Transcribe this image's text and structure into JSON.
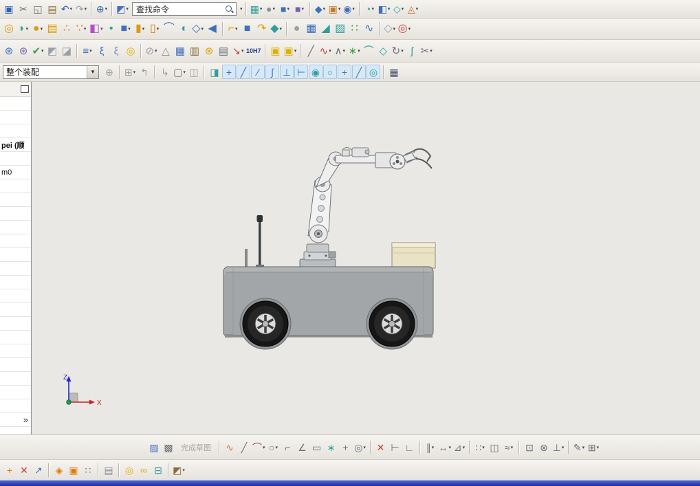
{
  "search": {
    "value": "查找命令"
  },
  "assembly_combo": {
    "value": "整个装配"
  },
  "left_panel": {
    "expand_arrow": "»",
    "rows": [
      {
        "label": ""
      },
      {
        "label": ""
      },
      {
        "label": ""
      },
      {
        "label": "pei (顺",
        "bold": true
      },
      {
        "label": ""
      },
      {
        "label": "m0"
      },
      {
        "label": ""
      },
      {
        "label": ""
      },
      {
        "label": ""
      },
      {
        "label": ""
      },
      {
        "label": ""
      },
      {
        "label": ""
      },
      {
        "label": ""
      },
      {
        "label": ""
      },
      {
        "label": ""
      },
      {
        "label": ""
      },
      {
        "label": ""
      },
      {
        "label": ""
      },
      {
        "label": ""
      },
      {
        "label": ""
      },
      {
        "label": ""
      },
      {
        "label": ""
      },
      {
        "label": ""
      },
      {
        "label": ""
      }
    ]
  },
  "viewport": {
    "triad": {
      "z_label": "Z",
      "x_label": "X"
    }
  },
  "bottom": {
    "finish_label": "完成草图"
  },
  "toolbars": {
    "row1a": [
      {
        "name": "window-menu-icon",
        "glyph": "▣",
        "color": "#2b5fb4"
      },
      {
        "name": "cut-icon",
        "glyph": "✂",
        "color": "#6b7076"
      },
      {
        "name": "copy-icon",
        "glyph": "◱",
        "color": "#6b7076"
      },
      {
        "name": "paste-icon",
        "glyph": "▤",
        "color": "#8a6d3b"
      },
      {
        "name": "undo-icon",
        "glyph": "↶",
        "color": "#2b5fb4",
        "dd": true
      },
      {
        "name": "redo-icon",
        "glyph": "↷",
        "color": "#9aa0a6",
        "dd": true
      },
      {
        "name": "datum-csys-icon",
        "glyph": "⊕",
        "color": "#2b5fb4",
        "dd": true,
        "sep": true
      },
      {
        "name": "sketch-icon",
        "glyph": "◩",
        "color": "#3f6fbf",
        "dd": true,
        "sep": true
      }
    ],
    "row1b": [
      {
        "name": "snap-view-icon",
        "glyph": "▦",
        "color": "#2f9e9e",
        "dd": true,
        "sep": true
      },
      {
        "name": "rotate-view-icon",
        "glyph": "●",
        "color": "#8e9399",
        "dd": true
      },
      {
        "name": "extrude-icon",
        "glyph": "■",
        "color": "#3f6fbf",
        "dd": true
      },
      {
        "name": "block-icon",
        "glyph": "■",
        "color": "#7a5fb4",
        "dd": true
      },
      {
        "name": "boolean-icon",
        "glyph": "◆",
        "color": "#3f6fbf",
        "dd": true,
        "sep": true
      },
      {
        "name": "feature-group-icon",
        "glyph": "▣",
        "color": "#c47a2b",
        "dd": true
      },
      {
        "name": "hole-icon",
        "glyph": "◉",
        "color": "#3f6fbf",
        "dd": true
      },
      {
        "name": "edge-blend-icon",
        "glyph": "◔",
        "color": "#2f9e9e",
        "dd": true,
        "sep": true
      },
      {
        "name": "move-face-icon",
        "glyph": "◧",
        "color": "#3f6fbf",
        "dd": true
      },
      {
        "name": "sheet-icon",
        "glyph": "◇",
        "color": "#2f9e9e",
        "dd": true
      },
      {
        "name": "analysis-icon",
        "glyph": "◬",
        "color": "#c47a2b",
        "dd": true
      }
    ],
    "row2": [
      {
        "name": "torus-icon",
        "glyph": "◎",
        "color": "#e09b00"
      },
      {
        "name": "revolve-icon",
        "glyph": "◗",
        "color": "#2f9e9e",
        "dd": true
      },
      {
        "name": "sphere-icon",
        "glyph": "●",
        "color": "#d8a018",
        "dd": true
      },
      {
        "name": "layer-icon",
        "glyph": "▤",
        "color": "#e09b00"
      },
      {
        "name": "pattern-dots-icon",
        "glyph": "∴",
        "color": "#e07b00"
      },
      {
        "name": "pattern-dots2-icon",
        "glyph": "∵",
        "color": "#e07b00",
        "dd": true
      },
      {
        "name": "add-component-icon",
        "glyph": "◧",
        "color": "#b44fcc",
        "dd": true
      },
      {
        "name": "point-icon",
        "glyph": "•",
        "color": "#2f9e9e"
      },
      {
        "name": "block2-icon",
        "glyph": "■",
        "color": "#3f6fbf",
        "dd": true
      },
      {
        "name": "boss-icon",
        "glyph": "▮",
        "color": "#e09b00",
        "dd": true
      },
      {
        "name": "pad-icon",
        "glyph": "▯",
        "color": "#e07b00",
        "dd": true
      },
      {
        "name": "bend-icon",
        "glyph": "⌒",
        "color": "#3f6fbf"
      },
      {
        "name": "sweep-icon",
        "glyph": "◖",
        "color": "#2f9e9e"
      },
      {
        "name": "surface-icon",
        "glyph": "◇",
        "color": "#3f6fbf",
        "dd": true
      },
      {
        "name": "reverse-icon",
        "glyph": "◀",
        "color": "#3f6fbf"
      },
      {
        "name": "flange-icon",
        "glyph": "⌐",
        "color": "#e09b00",
        "dd": true,
        "sep": true
      },
      {
        "name": "cube-icon",
        "glyph": "■",
        "color": "#3f6fbf"
      },
      {
        "name": "hook-icon",
        "glyph": "↷",
        "color": "#e09b00"
      },
      {
        "name": "face-icon",
        "glyph": "◆",
        "color": "#2f9e9e",
        "dd": true
      },
      {
        "name": "ball-icon",
        "glyph": "●",
        "color": "#9aa0a6",
        "sep": true
      },
      {
        "name": "table-icon",
        "glyph": "▦",
        "color": "#3f6fbf"
      },
      {
        "name": "draft-icon",
        "glyph": "◢",
        "color": "#2f9e9e"
      },
      {
        "name": "hatch-icon",
        "glyph": "▨",
        "color": "#2f9e9e"
      },
      {
        "name": "point-set-icon",
        "glyph": "∷",
        "color": "#3aa04a"
      },
      {
        "name": "studio-spline-icon",
        "glyph": "∿",
        "color": "#3f6fbf"
      },
      {
        "name": "sheet2-icon",
        "glyph": "◇",
        "color": "#9aa0a6",
        "dd": true,
        "sep": true
      },
      {
        "name": "target-icon",
        "glyph": "◎",
        "color": "#cc3b3b",
        "dd": true
      }
    ],
    "row3": [
      {
        "name": "gear-pair-icon",
        "glyph": "⊛",
        "color": "#3f6fbf"
      },
      {
        "name": "gear2-icon",
        "glyph": "⊛",
        "color": "#7a5fb4"
      },
      {
        "name": "verify-icon",
        "glyph": "✔",
        "color": "#3aa04a",
        "dd": true
      },
      {
        "name": "plane-icon",
        "glyph": "◩",
        "color": "#9aa0a6"
      },
      {
        "name": "plane2-icon",
        "glyph": "◪",
        "color": "#9aa0a6"
      },
      {
        "name": "list-icon",
        "glyph": "≡",
        "color": "#3f6fbf",
        "dd": true,
        "sep": true
      },
      {
        "name": "spring-icon",
        "glyph": "ξ",
        "color": "#3f6fbf"
      },
      {
        "name": "spring2-icon",
        "glyph": "ξ",
        "color": "#6a8fd8"
      },
      {
        "name": "coil-icon",
        "glyph": "◎",
        "color": "#e0b000"
      },
      {
        "name": "disable-icon",
        "glyph": "⊘",
        "color": "#9aa0a6",
        "dd": true,
        "sep": true
      },
      {
        "name": "triangle-icon",
        "glyph": "△",
        "color": "#8a8f94"
      },
      {
        "name": "grid-table-icon",
        "glyph": "▦",
        "color": "#3f6fbf"
      },
      {
        "name": "frame-icon",
        "glyph": "▥",
        "color": "#8a6d3b"
      },
      {
        "name": "gears-icon",
        "glyph": "⊛",
        "color": "#e09b00"
      },
      {
        "name": "doc-icon",
        "glyph": "▤",
        "color": "#6b7076"
      },
      {
        "name": "measure-icon",
        "glyph": "↘",
        "color": "#cc3b3b",
        "dd": true
      },
      {
        "name": "tolerance-icon",
        "text": "10H7",
        "color": "#203a8c"
      },
      {
        "name": "box-yellow-icon",
        "glyph": "▣",
        "color": "#e0b000",
        "sep": true
      },
      {
        "name": "box-yellow2-icon",
        "glyph": "▣",
        "color": "#e0b000",
        "dd": true
      },
      {
        "name": "line-icon",
        "glyph": "╱",
        "color": "#6b7076",
        "sep": true
      },
      {
        "name": "curve-icon",
        "glyph": "∿",
        "color": "#cc3b3b",
        "dd": true
      },
      {
        "name": "polyline-icon",
        "glyph": "∧",
        "color": "#6b7076",
        "dd": true
      },
      {
        "name": "point-star-icon",
        "glyph": "∗",
        "color": "#3aa04a",
        "dd": true
      },
      {
        "name": "arc-icon",
        "glyph": "⌒",
        "color": "#2f9e9e"
      },
      {
        "name": "patch-icon",
        "glyph": "◇",
        "color": "#2f9e9e"
      },
      {
        "name": "spiral-icon",
        "glyph": "↻",
        "color": "#6b7076",
        "dd": true
      },
      {
        "name": "spline-icon",
        "glyph": "∫",
        "color": "#2f9e9e"
      },
      {
        "name": "trim-icon",
        "glyph": "✂",
        "color": "#6b7076",
        "dd": true
      }
    ],
    "row4": [
      {
        "name": "selection-filter-icon",
        "glyph": "⊕",
        "color": "#9aa0a6"
      },
      {
        "name": "snap-options-icon",
        "glyph": "⊞",
        "color": "#9aa0a6",
        "dd": true,
        "sep": true
      },
      {
        "name": "up-level-icon",
        "glyph": "↰",
        "color": "#9aa0a6"
      },
      {
        "name": "down-level-icon",
        "glyph": "↳",
        "color": "#9aa0a6",
        "sep": true
      },
      {
        "name": "marquee-select-icon",
        "glyph": "▢",
        "color": "#6b7076",
        "dd": true
      },
      {
        "name": "solid-select-icon",
        "glyph": "◫",
        "color": "#9aa0a6"
      },
      {
        "name": "shaded-select-icon",
        "glyph": "◨",
        "color": "#2f9e9e",
        "sep": true
      },
      {
        "name": "snap-point-icon",
        "glyph": "+",
        "color": "#3f6fbf",
        "hl": true
      },
      {
        "name": "snap-endpoint-icon",
        "glyph": "╱",
        "color": "#3f6fbf",
        "hl": true
      },
      {
        "name": "snap-midpoint-icon",
        "glyph": "∕",
        "color": "#3f6fbf",
        "hl": true
      },
      {
        "name": "snap-spline-icon",
        "glyph": "∫",
        "color": "#3f6fbf",
        "hl": true
      },
      {
        "name": "snap-axis-icon",
        "glyph": "⊥",
        "color": "#3f6fbf",
        "hl": true
      },
      {
        "name": "snap-perp-icon",
        "glyph": "⊢",
        "color": "#3f6fbf",
        "hl": true
      },
      {
        "name": "snap-center-icon",
        "glyph": "◉",
        "color": "#2f9e9e",
        "hl": true
      },
      {
        "name": "snap-circle-icon",
        "glyph": "○",
        "color": "#2f9e9e",
        "hl": true
      },
      {
        "name": "snap-intersection-icon",
        "glyph": "+",
        "color": "#6b7076",
        "hl": true
      },
      {
        "name": "snap-tangent-icon",
        "glyph": "╱",
        "color": "#6b7076",
        "hl": true
      },
      {
        "name": "snap-target-icon",
        "glyph": "◎",
        "color": "#2f9e9e",
        "hl": true
      },
      {
        "name": "grid-icon",
        "glyph": "▦",
        "color": "#44506b",
        "sep": true
      }
    ],
    "bottom1a": [
      {
        "name": "sketch-task-icon",
        "glyph": "▨",
        "color": "#3f6fbf"
      },
      {
        "name": "finish-sketch-icon",
        "glyph": "▩",
        "color": "#6b7076"
      }
    ],
    "bottom1b": [
      {
        "name": "profile-icon",
        "glyph": "∿",
        "color": "#cc7a2b",
        "sep": true
      },
      {
        "name": "line-tool-icon",
        "glyph": "╱",
        "color": "#6b7076"
      },
      {
        "name": "arc-tool-icon",
        "glyph": "⌒",
        "color": "#aa3333",
        "dd": true
      },
      {
        "name": "circle-tool-icon",
        "glyph": "○",
        "color": "#6b7076",
        "dd": true
      },
      {
        "name": "corner-arc-icon",
        "glyph": "⌐",
        "color": "#6b7076"
      },
      {
        "name": "chamfer-tool-icon",
        "glyph": "∠",
        "color": "#6b7076"
      },
      {
        "name": "rectangle-tool-icon",
        "glyph": "▭",
        "color": "#6b7076"
      },
      {
        "name": "polygon-tool-icon",
        "glyph": "∗",
        "color": "#2f9e9e"
      },
      {
        "name": "point-tool-icon",
        "glyph": "+",
        "color": "#6b7076"
      },
      {
        "name": "offset-tool-icon",
        "glyph": "◎",
        "color": "#6b7076",
        "dd": true
      },
      {
        "name": "quick-trim-icon",
        "glyph": "✕",
        "color": "#cc3b3b",
        "sep": true
      },
      {
        "name": "quick-extend-icon",
        "glyph": "⊢",
        "color": "#6b7076"
      },
      {
        "name": "make-corner-icon",
        "glyph": "∟",
        "color": "#6b7076"
      },
      {
        "name": "geometric-constraints-icon",
        "glyph": "∥",
        "color": "#6b7076",
        "dd": true,
        "sep": true
      },
      {
        "name": "dimension-icon",
        "glyph": "↔",
        "color": "#6b7076",
        "dd": true
      },
      {
        "name": "auto-dimension-icon",
        "glyph": "⊿",
        "color": "#6b7076",
        "dd": true
      },
      {
        "name": "pattern-curve-icon",
        "glyph": "∷",
        "color": "#6b7076",
        "dd": true,
        "sep": true
      },
      {
        "name": "mirror-curve-icon",
        "glyph": "◫",
        "color": "#6b7076"
      },
      {
        "name": "offset-curve-icon",
        "glyph": "≈",
        "color": "#6b7076",
        "dd": true
      },
      {
        "name": "project-curve-icon",
        "glyph": "⊡",
        "color": "#6b7076",
        "sep": true
      },
      {
        "name": "intersect-curve-icon",
        "glyph": "⊗",
        "color": "#6b7076"
      },
      {
        "name": "derived-lines-icon",
        "glyph": "⊥",
        "color": "#6b7076",
        "dd": true
      },
      {
        "name": "edit-curve-icon",
        "glyph": "✎",
        "color": "#6b7076",
        "dd": true,
        "sep": true
      },
      {
        "name": "sketch-orient-icon",
        "glyph": "⊞",
        "color": "#6b7076",
        "dd": true
      }
    ],
    "bottom2": [
      {
        "name": "measure-point-icon",
        "glyph": "+",
        "color": "#e07b00"
      },
      {
        "name": "csys-icon",
        "glyph": "✕",
        "color": "#cc3b3b"
      },
      {
        "name": "vector-icon",
        "glyph": "↗",
        "color": "#3f6fbf"
      },
      {
        "name": "move-component-icon",
        "glyph": "◈",
        "color": "#e07b00",
        "sep": true
      },
      {
        "name": "assembly-constraints-icon",
        "glyph": "▣",
        "color": "#e07b00"
      },
      {
        "name": "pattern-component-icon",
        "glyph": "∷",
        "color": "#6b7076"
      },
      {
        "name": "drafting-icon",
        "glyph": "▤",
        "color": "#8a8f94",
        "sep": true
      },
      {
        "name": "ring-icon",
        "glyph": "◎",
        "color": "#e0b000",
        "sep": true
      },
      {
        "name": "chain-icon",
        "glyph": "∞",
        "color": "#e0b000"
      },
      {
        "name": "clip-section-icon",
        "glyph": "⊟",
        "color": "#2f9e9e"
      },
      {
        "name": "exploded-view-icon",
        "glyph": "◩",
        "color": "#8a6d3b",
        "dd": true,
        "sep": true
      }
    ]
  }
}
